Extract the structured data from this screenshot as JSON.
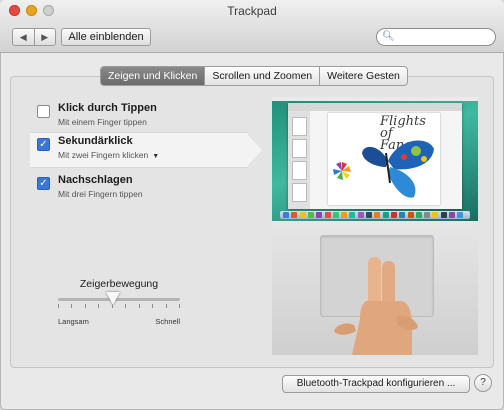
{
  "window": {
    "title": "Trackpad",
    "show_all": "Alle einblenden",
    "nav_back_icon": "chevron-left-icon",
    "nav_forward_icon": "chevron-right-icon",
    "search": {
      "value": "",
      "placeholder": "",
      "icon": "search-icon"
    }
  },
  "tabs": [
    {
      "label": "Zeigen und Klicken",
      "active": true
    },
    {
      "label": "Scrollen und Zoomen",
      "active": false
    },
    {
      "label": "Weitere Gesten",
      "active": false
    }
  ],
  "options": [
    {
      "label": "Klick durch Tippen",
      "sub": "Mit einem Finger tippen",
      "checked": false,
      "selected": false
    },
    {
      "label": "Sekundärklick",
      "sub": "Mit zwei Fingern klicken",
      "checked": true,
      "selected": true
    },
    {
      "label": "Nachschlagen",
      "sub": "Mit drei Fingern tippen",
      "checked": true,
      "selected": false
    }
  ],
  "pointer_speed": {
    "title": "Zeigerbewegung",
    "min_label": "Langsam",
    "max_label": "Schnell",
    "value": 0.45
  },
  "preview": {
    "doc_title_line1": "Flights of",
    "doc_title_line2": "Fancy"
  },
  "footer": {
    "bluetooth_button": "Bluetooth-Trackpad konfigurieren ...",
    "help_button": "?"
  },
  "colors": {
    "checkbox_checked": "#3b77d8",
    "tab_active": "#6a6a6a",
    "desktop": "#2aa18a"
  }
}
